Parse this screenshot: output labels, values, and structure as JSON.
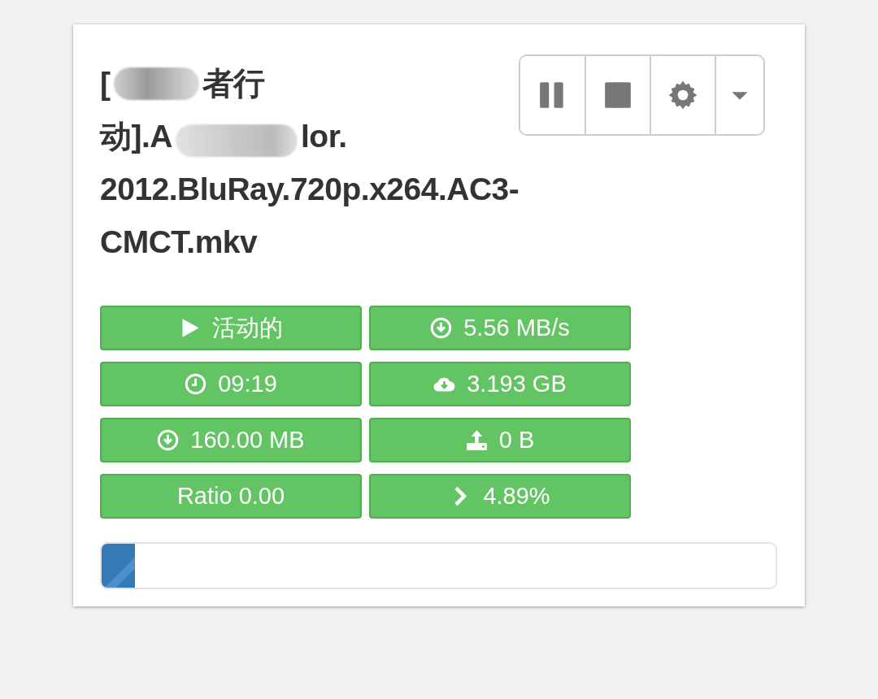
{
  "title_lines": [
    [
      {
        "kind": "text",
        "text": "["
      },
      {
        "kind": "redacted"
      },
      {
        "kind": "text",
        "text": "者行"
      }
    ],
    [
      {
        "kind": "text",
        "text": "动].A"
      },
      {
        "kind": "redacted"
      },
      {
        "kind": "text",
        "text": "lor."
      }
    ],
    [
      {
        "kind": "text",
        "text": "2012.BluRay.720p.x264.AC3-"
      }
    ],
    [
      {
        "kind": "text",
        "text": "CMCT.mkv"
      }
    ]
  ],
  "toolbar": [
    {
      "kind": "pause"
    },
    {
      "kind": "stop"
    },
    {
      "kind": "settings"
    },
    {
      "kind": "dropdown"
    }
  ],
  "stats": [
    {
      "kind": "status",
      "text": "活动的"
    },
    {
      "kind": "speed",
      "text": "5.56 MB/s"
    },
    {
      "kind": "eta",
      "text": "09:19"
    },
    {
      "kind": "size",
      "text": "3.193 GB"
    },
    {
      "kind": "downloaded",
      "text": "160.00 MB"
    },
    {
      "kind": "uploaded",
      "text": "0 B"
    },
    {
      "kind": "ratio",
      "text": "Ratio 0.00"
    },
    {
      "kind": "percent",
      "text": "4.89%"
    }
  ],
  "progress": {
    "level": 0.0489
  }
}
